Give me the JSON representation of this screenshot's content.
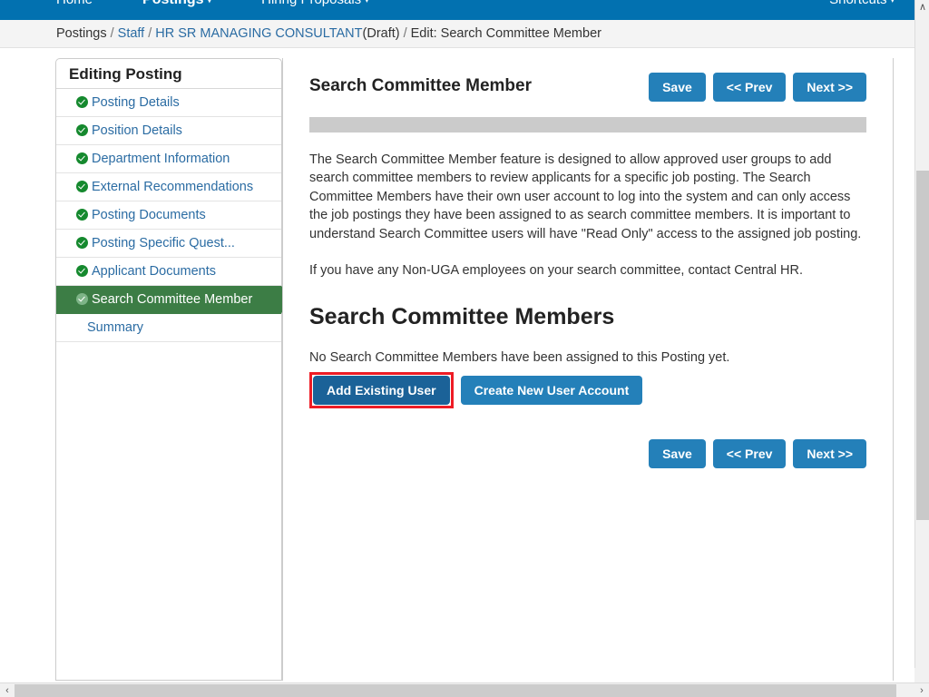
{
  "topnav": {
    "items": [
      {
        "label": "Home",
        "has_caret": false,
        "active": false
      },
      {
        "label": "Postings",
        "has_caret": true,
        "active": true
      },
      {
        "label": "Hiring Proposals",
        "has_caret": true,
        "active": false
      }
    ],
    "right_item": {
      "label": "Shortcuts",
      "has_caret": true
    },
    "caret_glyph": "▾",
    "background_color": "#0271b0"
  },
  "breadcrumb": {
    "item1": "Postings",
    "item2": "Staff",
    "item3": "HR SR MANAGING CONSULTANT",
    "item3_status": "(Draft)",
    "item4": "Edit: Search Committee Member",
    "separator": "/"
  },
  "sidebar": {
    "header": "Editing Posting",
    "items": [
      {
        "label": "Posting Details",
        "complete": true,
        "current": false
      },
      {
        "label": "Position Details",
        "complete": true,
        "current": false
      },
      {
        "label": "Department Information",
        "complete": true,
        "current": false
      },
      {
        "label": "External Recommendations",
        "complete": true,
        "current": false
      },
      {
        "label": "Posting Documents",
        "complete": true,
        "current": false
      },
      {
        "label": "Posting Specific Quest...",
        "complete": true,
        "current": false
      },
      {
        "label": "Applicant Documents",
        "complete": true,
        "current": false
      },
      {
        "label": "Search Committee Member",
        "complete": true,
        "current": true
      },
      {
        "label": "Summary",
        "complete": false,
        "current": false
      }
    ],
    "current_color": "#3c7d45",
    "check_color": "#15892e",
    "link_color": "#2b6ca3"
  },
  "main": {
    "page_title": "Search Committee Member",
    "top_buttons": [
      {
        "label": "Save"
      },
      {
        "label": "<< Prev"
      },
      {
        "label": "Next >>"
      }
    ],
    "paragraph1": "The Search Committee Member feature is designed to allow approved user groups to add search committee members to review applicants for a specific job posting. The Search Committee Members have their own user account to log into the system and can only access the job postings they have been assigned to as search committee members. It is important to understand Search Committee users will have \"Read Only\" access to the assigned job posting.",
    "paragraph2": "If you have any Non-UGA employees on your search committee, contact Central HR.",
    "section_title": "Search Committee Members",
    "empty_message": "No Search Committee Members have been assigned to this Posting yet.",
    "add_existing_user_button": "Add Existing User",
    "create_new_user_button": "Create New User Account",
    "bottom_buttons": [
      {
        "label": "Save"
      },
      {
        "label": "<< Prev"
      },
      {
        "label": "Next >>"
      }
    ],
    "button_color": "#2480b9",
    "highlight_color": "#ee1c25"
  },
  "scrollbars": {
    "up_arrow": "∧",
    "down_arrow": "∨",
    "left_arrow": "‹",
    "right_arrow": "›"
  }
}
